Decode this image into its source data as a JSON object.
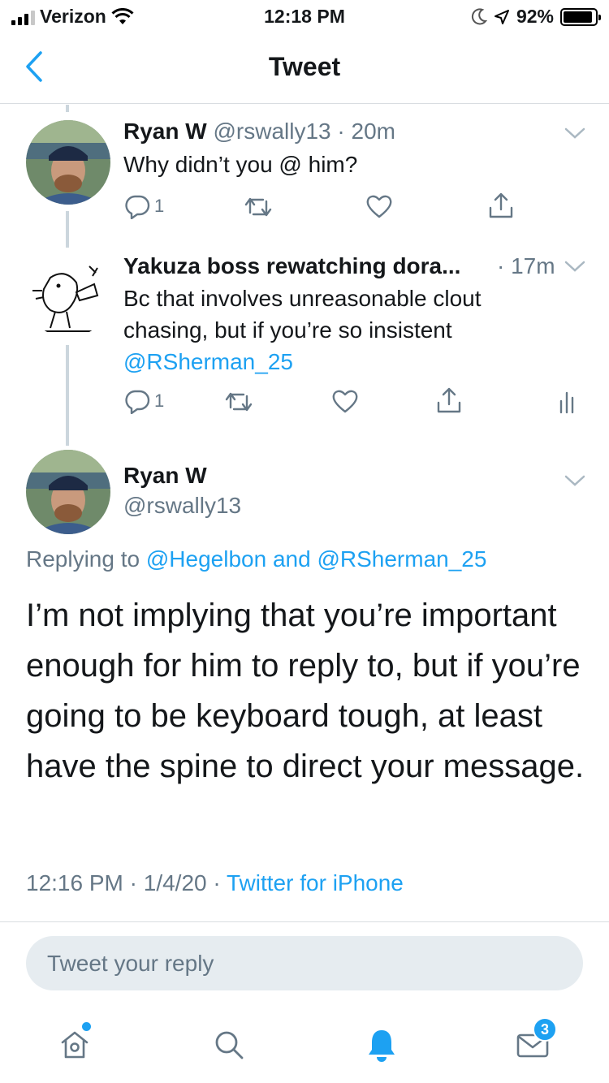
{
  "status_bar": {
    "carrier": "Verizon",
    "time": "12:18 PM",
    "battery": "92%",
    "battery_level": 0.92
  },
  "nav": {
    "title": "Tweet"
  },
  "thread": [
    {
      "name": "Ryan W",
      "handle": "@rswally13",
      "time": "· 20m",
      "text": "Why didn’t you @ him?",
      "reply_count": "1"
    },
    {
      "name": "Yakuza boss rewatching dora...",
      "time": "· 17m",
      "text": "Bc that involves unreasonable clout chasing, but if you’re so insistent",
      "mention": "@RSherman_25",
      "reply_count": "1"
    }
  ],
  "main_tweet": {
    "name": "Ryan W",
    "handle": "@rswally13",
    "replying_label": "Replying to",
    "replying_mention_1": "@Hegelbon",
    "replying_and": "and",
    "replying_mention_2": "@RSherman_25",
    "text": "I’m not implying that you’re important enough for him to reply to, but if you’re going to be keyboard tough, at least have the spine to direct your message.",
    "time": "12:16 PM",
    "date": "1/4/20",
    "source": "Twitter for iPhone"
  },
  "reply_box": {
    "placeholder": "Tweet your reply"
  },
  "tab_bar": {
    "messages_badge": "3"
  },
  "colors": {
    "accent": "#1da1f2",
    "secondary_text": "#657786",
    "primary_text": "#14171a",
    "divider": "#d9dde1"
  }
}
